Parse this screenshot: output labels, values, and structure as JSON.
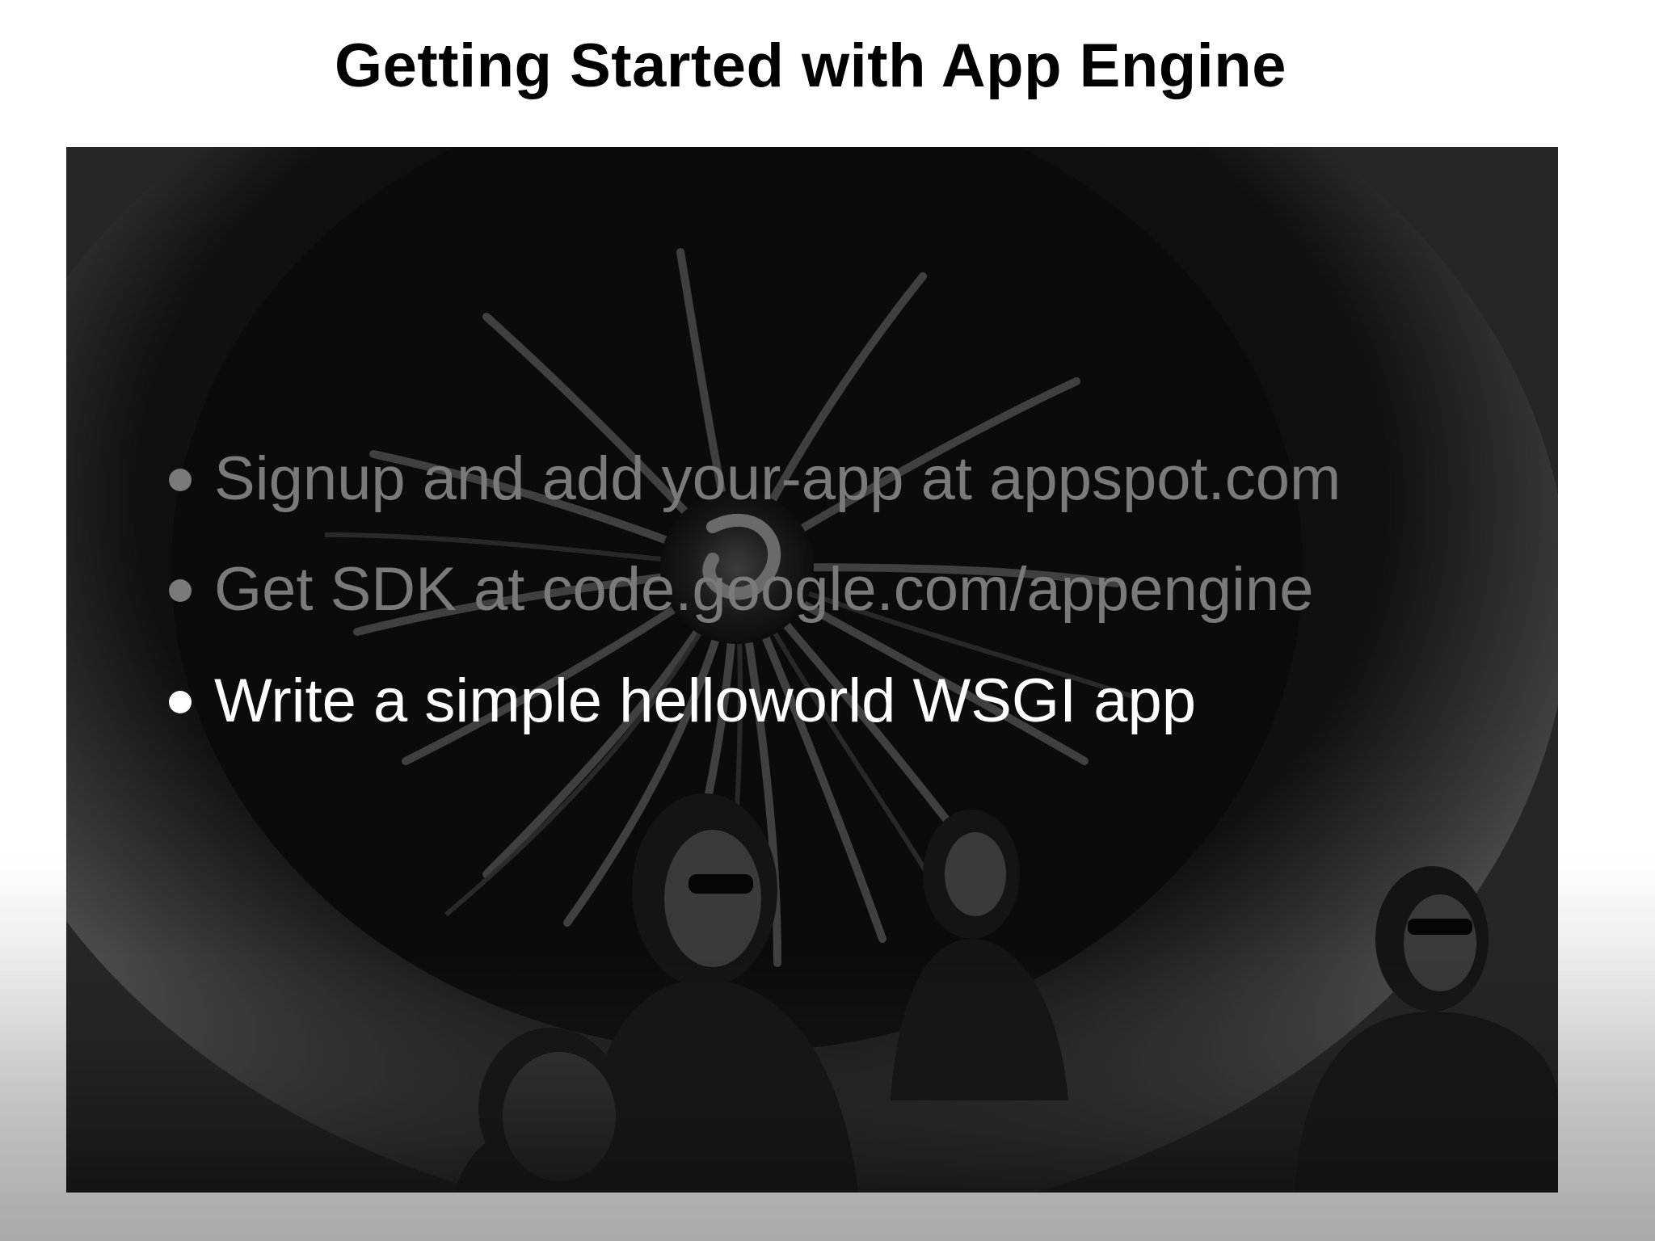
{
  "slide": {
    "title": "Getting Started with App Engine",
    "bullets": [
      {
        "text": "Signup and add your-app at appspot.com",
        "state": "dimmed"
      },
      {
        "text": "Get SDK at code.google.com/appengine",
        "state": "dimmed"
      },
      {
        "text": "Write a simple helloworld WSGI app",
        "state": "highlighted"
      }
    ]
  },
  "colors": {
    "title": "#000000",
    "dimmed_text": "#7a7a7a",
    "highlighted_text": "#ffffff",
    "photo_tint": "#1e1e1e"
  },
  "icons": {
    "bullet": "bullet-dot-icon",
    "photo": "jet-engine-photo"
  }
}
